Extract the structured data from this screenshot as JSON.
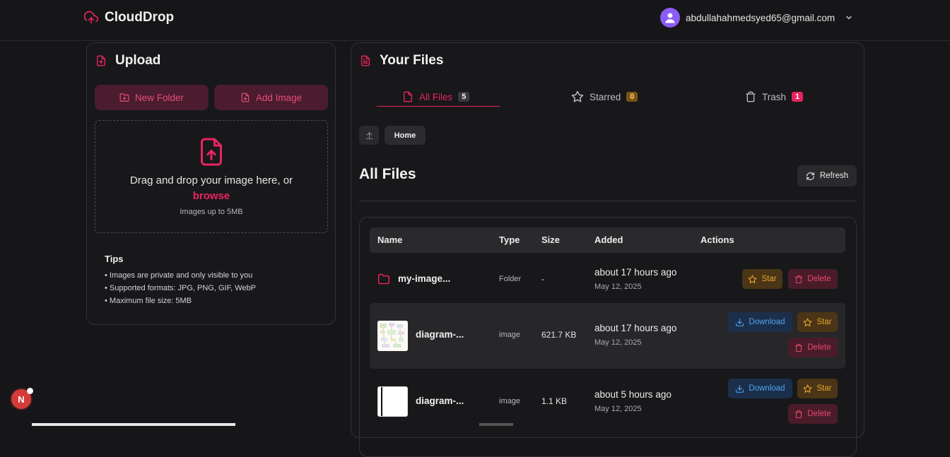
{
  "app": {
    "name": "CloudDrop",
    "brand_color": "#e8245e"
  },
  "user": {
    "email": "abdullahahmedsyed65@gmail.com",
    "avatar_icon": "user-avatar-icon"
  },
  "upload": {
    "title": "Upload",
    "new_folder_label": "New Folder",
    "add_image_label": "Add Image",
    "drop_text": "Drag and drop your image here, or",
    "browse_label": "browse",
    "hint": "Images up to 5MB",
    "tips_title": "Tips",
    "tips": [
      "• Images are private and only visible to you",
      "• Supported formats: JPG, PNG, GIF, WebP",
      "• Maximum file size: 5MB"
    ]
  },
  "files": {
    "title": "Your Files",
    "tabs": [
      {
        "label": "All Files",
        "count": "5",
        "active": true,
        "badge_color": "#3a3a3e"
      },
      {
        "label": "Starred",
        "count": "0",
        "active": false,
        "badge_color": "#7a5412"
      },
      {
        "label": "Trash",
        "count": "1",
        "active": false,
        "badge_color": "#e8245e"
      }
    ],
    "breadcrumb": {
      "home": "Home"
    },
    "section_title": "All Files",
    "refresh_label": "Refresh",
    "columns": [
      "Name",
      "Type",
      "Size",
      "Added",
      "Actions"
    ],
    "rows": [
      {
        "name": "my-image...",
        "type": "Folder",
        "size": "-",
        "added_rel": "about 17 hours ago",
        "added_date": "May 12, 2025",
        "actions": [
          "Star",
          "Delete"
        ]
      },
      {
        "name": "diagram-...",
        "type": "image",
        "size": "621.7 KB",
        "added_rel": "about 17 hours ago",
        "added_date": "May 12, 2025",
        "actions": [
          "Download",
          "Star",
          "Delete"
        ]
      },
      {
        "name": "diagram-...",
        "type": "image",
        "size": "1.1 KB",
        "added_rel": "about 5 hours ago",
        "added_date": "May 12, 2025",
        "actions": [
          "Download",
          "Star",
          "Delete"
        ]
      }
    ]
  },
  "dev_badge": {
    "letter": "N"
  }
}
